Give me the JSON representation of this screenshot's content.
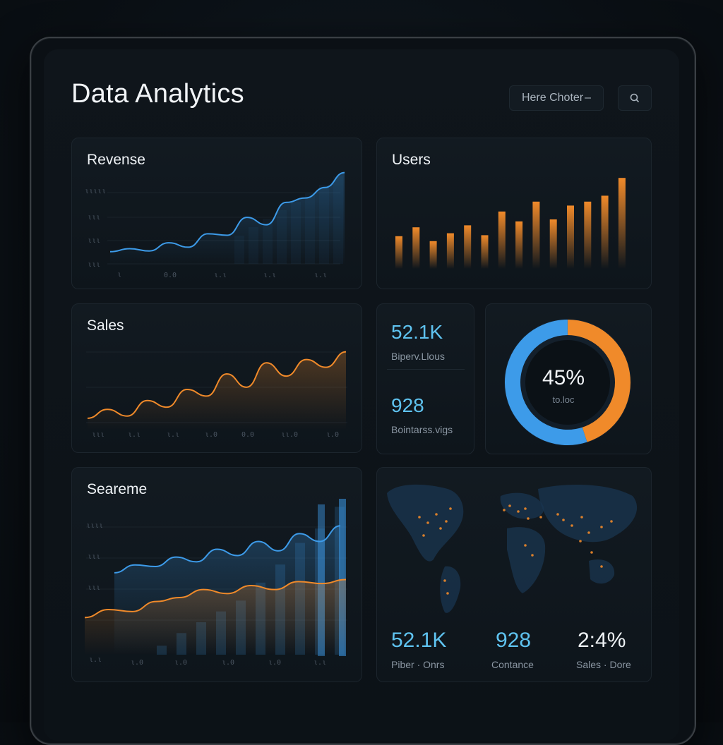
{
  "header": {
    "title": "Data Analytics",
    "filter_label": "Here Choter",
    "search_icon": "search-icon"
  },
  "cards": {
    "revenue": {
      "title": "Revense",
      "y_ticks": [
        "ιιιιι",
        "ιιι",
        "ιιι",
        "ιιι"
      ],
      "x_ticks": [
        "ι",
        "0.0",
        "ι.ι",
        "ι.ι",
        "ι.ι"
      ]
    },
    "users": {
      "title": "Users"
    },
    "sales": {
      "title": "Sales",
      "x_ticks": [
        "ιιι",
        "ι.ι",
        "ι.ι",
        "ι.0",
        "0.0",
        "ιι.0",
        "ι.0"
      ]
    },
    "stats": {
      "value1": "52.1K",
      "label1": "Biperv.Llous",
      "value2": "928",
      "label2": "Bointarss.vigs"
    },
    "donut": {
      "percent_label": "45%",
      "sub_label": "to.loc"
    },
    "searche": {
      "title": "Seareme",
      "y_ticks": [
        "ιιιι",
        "ιιι",
        "ιιι"
      ],
      "x_ticks": [
        "ι.ι",
        "ι.0",
        "ι.0",
        "ι.0",
        "ι.0",
        "ι.ι"
      ]
    },
    "map": {
      "stats": [
        {
          "value": "52.1K",
          "label": "Piber · Onrs"
        },
        {
          "value": "928",
          "label": "Contance"
        },
        {
          "value": "2:4%",
          "label": "Sales · Dore"
        }
      ]
    }
  },
  "colors": {
    "blue": "#3d9be9",
    "orange": "#f08a2a",
    "cyan": "#5fc3f0"
  },
  "chart_data": [
    {
      "type": "line",
      "title": "Revense",
      "series": [
        {
          "values": [
            2,
            4,
            2.5,
            8,
            5,
            14,
            13,
            25,
            20,
            35,
            38,
            45,
            55
          ]
        }
      ],
      "ylim": [
        0,
        60
      ]
    },
    {
      "type": "bar",
      "title": "Users",
      "values": [
        33,
        42,
        28,
        36,
        44,
        34,
        58,
        48,
        68,
        50,
        64,
        68,
        74,
        92
      ],
      "ylim": [
        0,
        100
      ]
    },
    {
      "type": "line",
      "title": "Sales",
      "series": [
        {
          "values": [
            2,
            10,
            4,
            18,
            12,
            28,
            22,
            42,
            30,
            52,
            40,
            55,
            48,
            62
          ]
        }
      ],
      "ylim": [
        0,
        70
      ]
    },
    {
      "type": "pie",
      "title": "",
      "values": [
        45,
        55
      ]
    },
    {
      "type": "line",
      "title": "Seareme",
      "series": [
        {
          "values": [
            10,
            20,
            18,
            30,
            24,
            40,
            32,
            50,
            38,
            60,
            50,
            70
          ]
        },
        {
          "values": [
            2,
            6,
            5,
            10,
            12,
            16,
            14,
            18,
            16,
            20,
            19,
            21
          ]
        }
      ],
      "bars": [
        5,
        12,
        18,
        24,
        30,
        40,
        50,
        62,
        70,
        82
      ],
      "ylim": [
        0,
        90
      ]
    }
  ]
}
